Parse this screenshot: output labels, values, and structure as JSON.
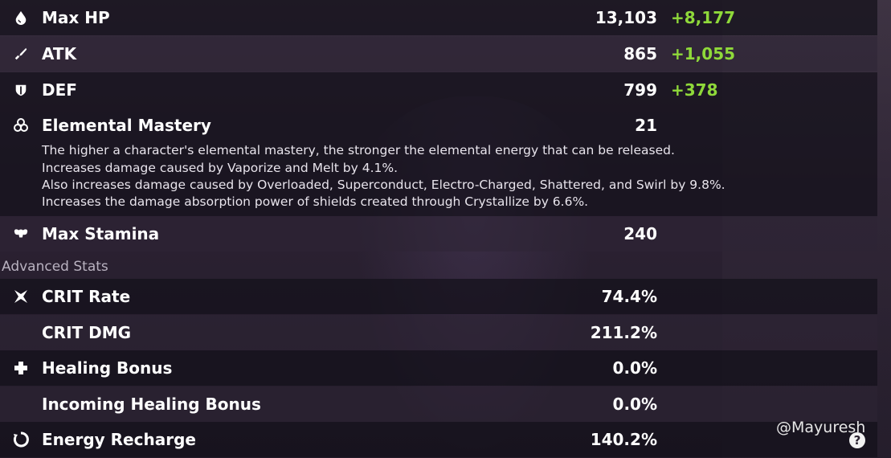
{
  "base_stats": [
    {
      "label": "Max HP",
      "value": "13,103",
      "bonus": "+8,177",
      "icon": "droplet-icon"
    },
    {
      "label": "ATK",
      "value": "865",
      "bonus": "+1,055",
      "icon": "sword-icon"
    },
    {
      "label": "DEF",
      "value": "799",
      "bonus": "+378",
      "icon": "shield-icon"
    },
    {
      "label": "Elemental Mastery",
      "value": "21",
      "icon": "elemental-mastery-icon"
    },
    {
      "label": "Max Stamina",
      "value": "240",
      "icon": "stamina-icon"
    }
  ],
  "elemental_mastery_description": [
    "The higher a character's elemental mastery, the stronger the elemental energy that can be released.",
    "Increases damage caused by Vaporize and Melt by 4.1%.",
    "Also increases damage caused by Overloaded, Superconduct, Electro-Charged, Shattered, and Swirl by 9.8%.",
    "Increases the damage absorption power of shields created through Crystallize by 6.6%."
  ],
  "advanced_section_title": "Advanced Stats",
  "advanced_stats": [
    {
      "label": "CRIT Rate",
      "value": "74.4%",
      "icon": "crit-rate-icon"
    },
    {
      "label": "CRIT DMG",
      "value": "211.2%",
      "icon": ""
    },
    {
      "label": "Healing Bonus",
      "value": "0.0%",
      "icon": "plus-icon"
    },
    {
      "label": "Incoming Healing Bonus",
      "value": "0.0%",
      "icon": ""
    },
    {
      "label": "Energy Recharge",
      "value": "140.2%",
      "icon": "energy-recharge-icon"
    }
  ],
  "watermark": "@Mayuresh",
  "help_icon_glyph": "?",
  "colors": {
    "bonus_green": "#8fd93a",
    "text_white": "#ffffff",
    "section_grey": "#b9b2c0"
  }
}
